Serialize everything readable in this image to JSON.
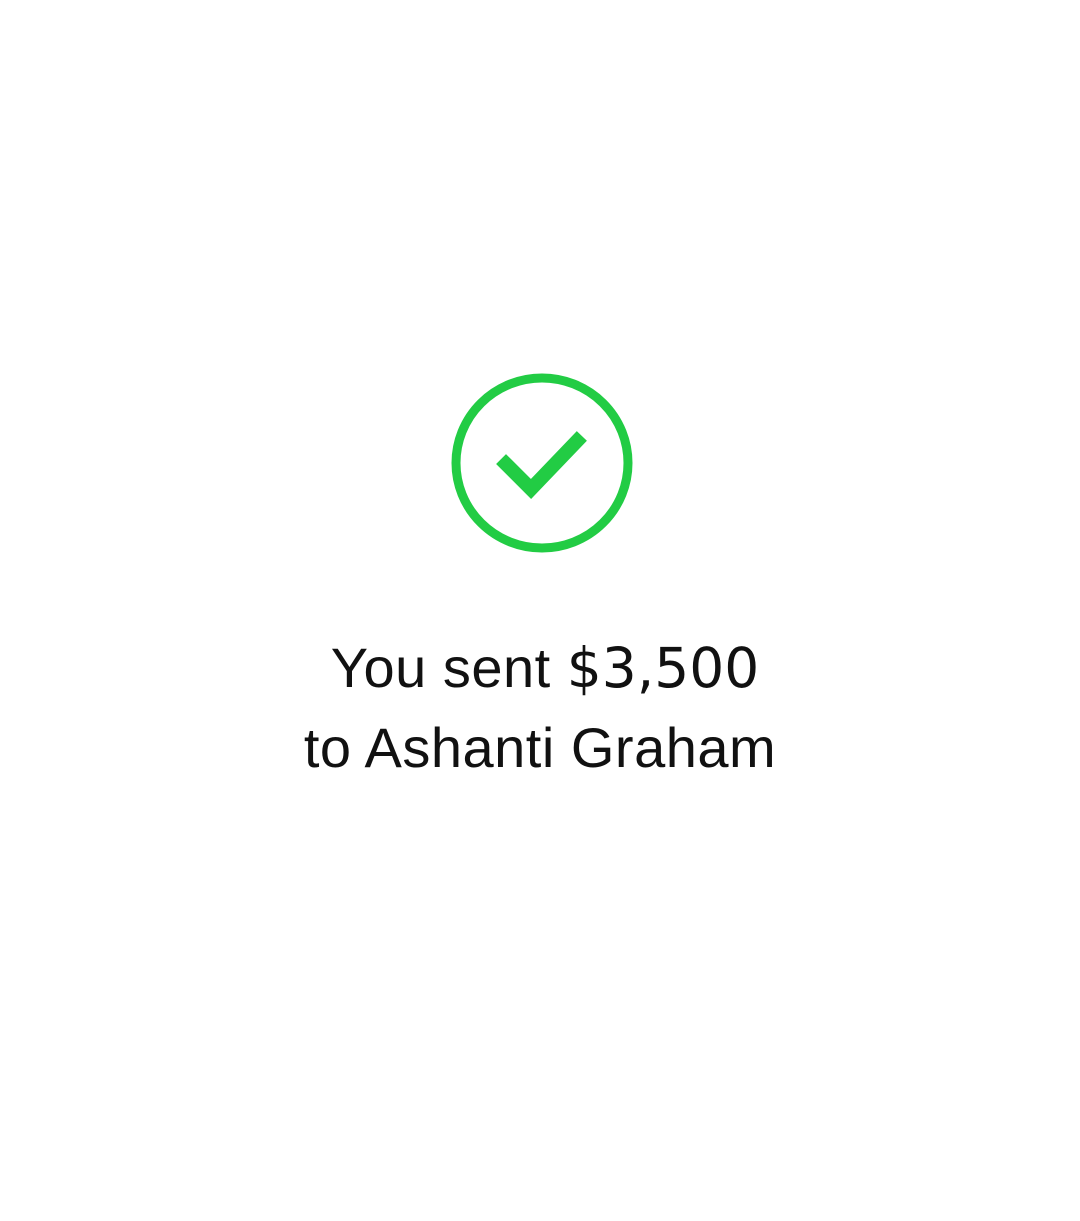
{
  "confirmation": {
    "icon": "check-circle-icon",
    "accent_color": "#22CC44",
    "message_prefix": "You sent",
    "amount": "$3,500",
    "message_recipient": "to Ashanti Graham"
  }
}
